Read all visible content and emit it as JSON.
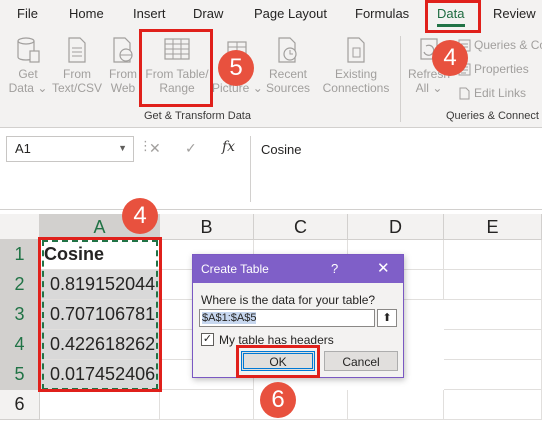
{
  "ribbon_tabs": [
    "File",
    "Home",
    "Insert",
    "Draw",
    "Page Layout",
    "Formulas",
    "Data",
    "Review"
  ],
  "active_tab": "Data",
  "get_transform": {
    "buttons": [
      {
        "label1": "Get",
        "label2": "Data",
        "icon": "database-icon"
      },
      {
        "label1": "From",
        "label2": "Text/CSV",
        "icon": "text-file-icon"
      },
      {
        "label1": "From",
        "label2": "Web",
        "icon": "web-page-icon"
      },
      {
        "label1": "From Table/",
        "label2": "Range",
        "icon": "table-icon"
      },
      {
        "label1": "",
        "label2": "Picture",
        "icon": "picture-icon"
      },
      {
        "label1": "Recent",
        "label2": "Sources",
        "icon": "recent-sources-icon"
      },
      {
        "label1": "Existing",
        "label2": "Connections",
        "icon": "existing-connections-icon"
      }
    ],
    "group_label": "Get & Transform Data"
  },
  "queries": {
    "refresh_label1": "Refresh",
    "refresh_label2": "All",
    "items": [
      "Queries & Co",
      "Properties",
      "Edit Links"
    ],
    "group_label": "Queries & Connect"
  },
  "formula_bar": {
    "name_box": "A1",
    "fx": "fx",
    "cancel": "✕",
    "enter": "✓",
    "content": "Cosine"
  },
  "sheet": {
    "columns": [
      "A",
      "B",
      "C",
      "D",
      "E"
    ],
    "rows": [
      "1",
      "2",
      "3",
      "4",
      "5",
      "6"
    ],
    "cells_A": [
      "Cosine",
      "0.819152044",
      "0.707106781",
      "0.422618262",
      "0.017452406"
    ]
  },
  "dialog": {
    "title": "Create Table",
    "help": "?",
    "close": "✕",
    "question": "Where is the data for your table?",
    "range": "$A$1:$A$5",
    "collapse": "⬆",
    "headers_checked": true,
    "headers_label": "My table has headers",
    "ok": "OK",
    "cancel": "Cancel"
  },
  "annotations": {
    "badge_data_tab": "4",
    "badge_from_table": "5",
    "badge_column_a": "4",
    "badge_ok": "6",
    "highlight_color": "#e0201b",
    "badge_color": "#e8513e"
  }
}
